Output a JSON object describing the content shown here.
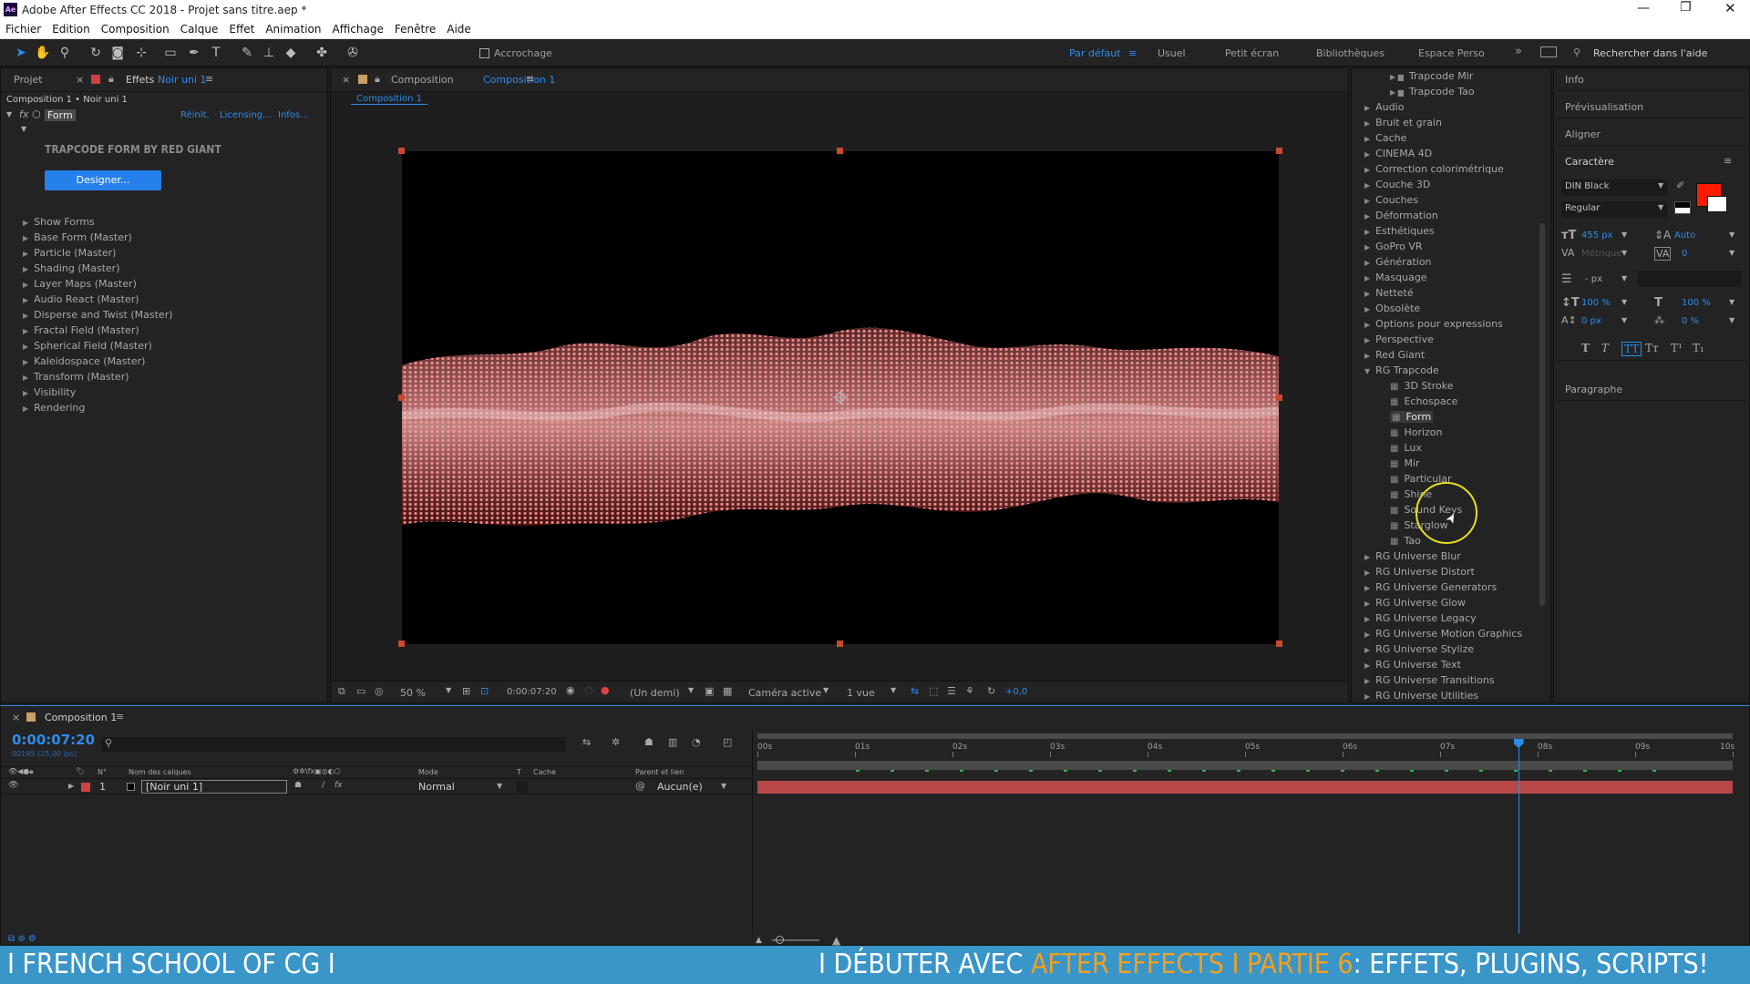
{
  "window": {
    "title": "Adobe After Effects CC 2018 - Projet sans titre.aep *",
    "app_badge": "Ae"
  },
  "menu": [
    "Fichier",
    "Edition",
    "Composition",
    "Calque",
    "Effet",
    "Animation",
    "Affichage",
    "Fenêtre",
    "Aide"
  ],
  "toolbar": {
    "snap_label": "Accrochage",
    "workspaces": [
      "Par défaut",
      "Usuel",
      "Petit écran",
      "Bibliothèques",
      "Espace Perso"
    ],
    "search_placeholder": "Rechercher dans l'aide"
  },
  "left_panel": {
    "tab_project": "Projet",
    "tab_effects": "Effets",
    "tab_layer": "Noir uni 1",
    "breadcrumb": "Composition 1 • Noir uni 1",
    "effect_name": "Form",
    "links": [
      "Réinit.",
      "Licensing...",
      "Infos..."
    ],
    "plugin_title": "TRAPCODE FORM BY RED GIANT",
    "designer_button": "Designer...",
    "properties": [
      "Show Forms",
      "Base Form (Master)",
      "Particle (Master)",
      "Shading (Master)",
      "Layer Maps (Master)",
      "Audio React (Master)",
      "Disperse and Twist (Master)",
      "Fractal Field (Master)",
      "Spherical Field (Master)",
      "Kaleidospace (Master)",
      "Transform (Master)",
      "Visibility",
      "Rendering"
    ]
  },
  "comp_panel": {
    "tab_prefix": "Composition",
    "tab_name": "Composition 1",
    "crumb": "Composition 1",
    "zoom": "50 %",
    "timecode": "0:00:07:20",
    "resolution": "(Un demi)",
    "camera": "Caméra active",
    "views": "1 vue",
    "exposure": "+0,0"
  },
  "effects_list": {
    "top_subitems": [
      "Trapcode Mir",
      "Trapcode Tao"
    ],
    "categories_before": [
      "Audio",
      "Bruit et grain",
      "Cache",
      "CINEMA 4D",
      "Correction colorimétrique",
      "Couche 3D",
      "Couches",
      "Déformation",
      "Esthétiques",
      "GoPro VR",
      "Génération",
      "Masquage",
      "Netteté",
      "Obsolète",
      "Options pour expressions",
      "Perspective",
      "Red Giant"
    ],
    "open_category": "RG Trapcode",
    "trapcode_items": [
      "3D Stroke",
      "Echospace",
      "Form",
      "Horizon",
      "Lux",
      "Mir",
      "Particular",
      "Shine",
      "Sound Keys",
      "Starglow",
      "Tao"
    ],
    "selected_item": "Form",
    "categories_after": [
      "RG Universe Blur",
      "RG Universe Distort",
      "RG Universe Generators",
      "RG Universe Glow",
      "RG Universe Legacy",
      "RG Universe Motion Graphics",
      "RG Universe Stylize",
      "RG Universe Text",
      "RG Universe Transitions",
      "RG Universe Utilities"
    ]
  },
  "right_panel": {
    "sections": [
      "Info",
      "Prévisualisation",
      "Aligner"
    ],
    "character_title": "Caractère",
    "font": "DIN Black",
    "style": "Regular",
    "size": "455 px",
    "leading": "Auto",
    "kerning": "Métrique",
    "tracking": "0",
    "stroke_width": "- px",
    "vscale": "100 %",
    "hscale": "100 %",
    "baseline": "0 px",
    "tsume": "0 %",
    "type_styles": [
      "T",
      "T",
      "TT",
      "Tт",
      "T¹",
      "T₁"
    ],
    "paragraph_title": "Paragraphe",
    "fill_color": "#ff1a00"
  },
  "timeline": {
    "tab": "Composition 1",
    "timecode": "0:00:07:20",
    "frame_info": "00195 (25,00 ips)",
    "col_num": "N°",
    "col_name": "Nom des calques",
    "col_mode": "Mode",
    "col_t": "T",
    "col_matte": "Cache",
    "col_parent": "Parent et lien",
    "layer_num": "1",
    "layer_name": "[Noir uni 1]",
    "layer_mode": "Normal",
    "layer_parent": "Aucun(e)",
    "ruler": [
      "00s",
      "01s",
      "02s",
      "03s",
      "04s",
      "05s",
      "06s",
      "07s",
      "08s",
      "09s",
      "10s"
    ],
    "playhead_seconds": 7.8,
    "duration_seconds": 10
  },
  "banner": {
    "left": "I FRENCH SCHOOL OF CG I",
    "right_part1": "I DÉBUTER AVEC ",
    "right_part2": "AFTER EFFECTS I PARTIE 6",
    "right_part3": ": EFFETS, PLUGINS, SCRIPTS!"
  }
}
